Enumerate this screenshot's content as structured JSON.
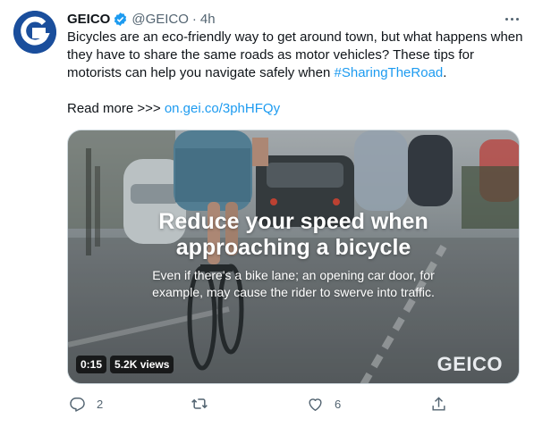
{
  "tweet": {
    "author_name": "GEICO",
    "handle": "@GEICO",
    "separator": "·",
    "time": "4h",
    "body_text": "Bicycles are an eco-friendly way to get around town, but what happens when they have to share the same roads as motor vehicles? These tips for motorists can help you navigate safely when ",
    "hashtag": "#SharingTheRoad",
    "body_end": ".",
    "read_more_label": "Read more >>> ",
    "read_more_link": "on.gei.co/3phHFQy"
  },
  "media": {
    "title_line1": "Reduce your speed when",
    "title_line2": "approaching a bicycle",
    "subtitle_line1": "Even if there's a bike lane; an opening car door, for",
    "subtitle_line2": "example, may cause the rider to swerve into traffic.",
    "duration": "0:15",
    "views": "5.2K views",
    "brand_watermark": "GEICO"
  },
  "actions": {
    "reply_count": "2",
    "retweet_count": "",
    "like_count": "6",
    "share_count": ""
  },
  "icons": {
    "avatar": "geico-logo-icon",
    "verified": "verified-badge-icon",
    "more": "more-icon",
    "reply": "reply-icon",
    "retweet": "retweet-icon",
    "like": "like-icon",
    "share": "share-icon"
  },
  "colors": {
    "accent": "#1d9bf0",
    "secondary_text": "#536471",
    "avatar_bg": "#1a4e9c"
  }
}
